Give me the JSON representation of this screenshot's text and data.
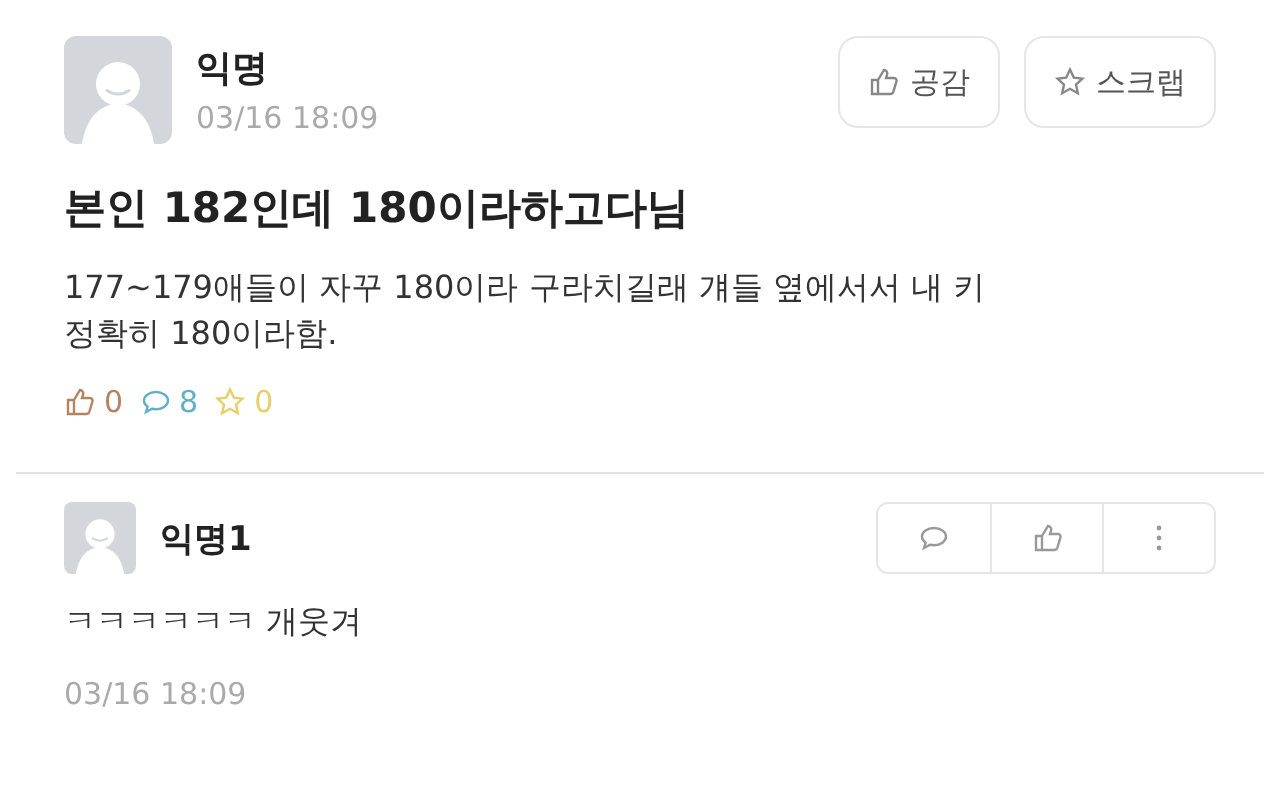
{
  "post": {
    "author": "익명",
    "time": "03/16 18:09",
    "actions": [
      {
        "kind": "like",
        "label": "공감"
      },
      {
        "kind": "scrap",
        "label": "스크랩"
      }
    ],
    "title": "본인 **182**인데 **180**이라하고다님",
    "body": "177~179애들이 자꾸 180이라 구라치길래 걔들 옆에서서 내 키 정확히 180이라함.",
    "stats": [
      {
        "kind": "like",
        "count": "0",
        "color": "#b5835f"
      },
      {
        "kind": "comment",
        "count": "8",
        "color": "#62b0c8"
      },
      {
        "kind": "scrap",
        "count": "0",
        "color": "#e6cf6a"
      }
    ]
  },
  "comments": [
    {
      "author": "익명1",
      "text": "ㅋㅋㅋㅋㅋㅋ 개웃겨",
      "time": "03/16 18:09",
      "actions": [
        {
          "kind": "comment"
        },
        {
          "kind": "like"
        },
        {
          "kind": "more"
        }
      ]
    }
  ]
}
